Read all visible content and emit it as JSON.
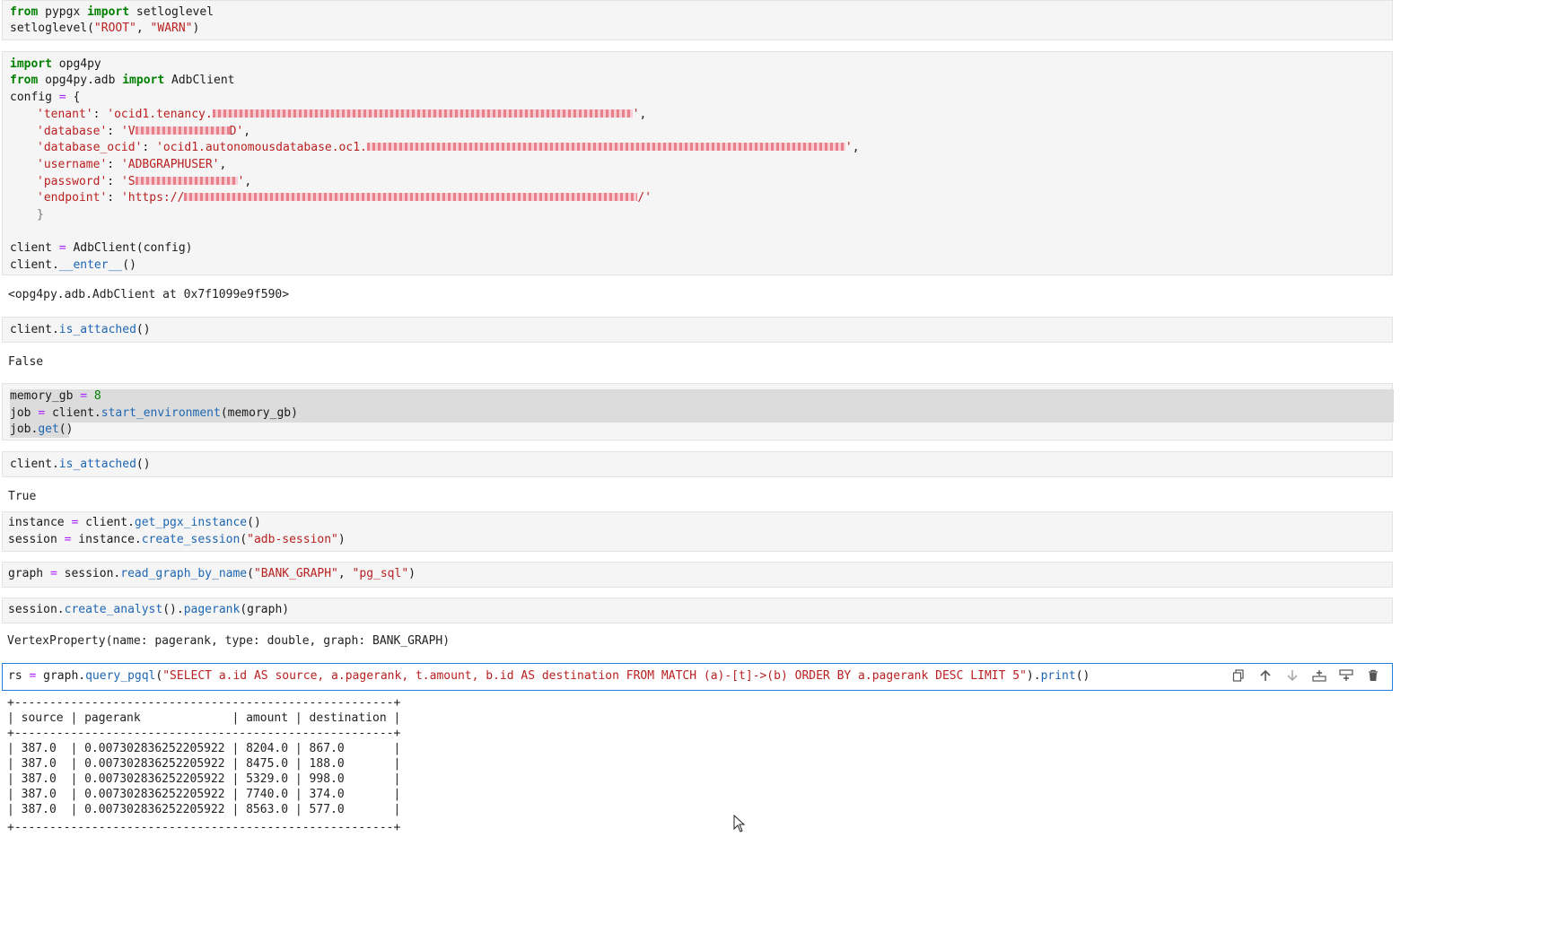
{
  "cells": {
    "c1": {
      "l1": {
        "kw1": "from",
        "mod": " pypgx ",
        "kw2": "import",
        "rest": " setloglevel"
      },
      "l2": {
        "fn": "setloglevel(",
        "s1": "\"ROOT\"",
        "sep": ", ",
        "s2": "\"WARN\"",
        "end": ")"
      }
    },
    "c2": {
      "l1": {
        "kw": "import",
        "rest": " opg4py"
      },
      "l2": {
        "kw1": "from",
        "mod": " opg4py.adb ",
        "kw2": "import",
        "rest": " AdbClient"
      },
      "l3": {
        "name": "config ",
        "op": "=",
        "rest": " {"
      },
      "tenant": {
        "key": "'tenant'",
        "sep": ": ",
        "val_start": "'ocid1.tenancy.",
        "val_end": "'",
        "tail": ","
      },
      "database": {
        "key": "'database'",
        "sep": ": ",
        "val_start": "'V",
        "val_end": "D'",
        "tail": ","
      },
      "database_ocid": {
        "key": "'database_ocid'",
        "sep": ": ",
        "val_start": "'ocid1.autonomousdatabase.oc1.",
        "val_end": "'",
        "tail": ","
      },
      "username": {
        "key": "'username'",
        "sep": ": ",
        "val": "'ADBGRAPHUSER'",
        "tail": ","
      },
      "password": {
        "key": "'password'",
        "sep": ": ",
        "val_start": "'S",
        "val_end": "'",
        "tail": ","
      },
      "endpoint": {
        "key": "'endpoint'",
        "sep": ": ",
        "val_start": "'https://",
        "val_end": "/'"
      },
      "close_brace": "}",
      "l10": {
        "name": "client ",
        "op": "=",
        "rest": " AdbClient(config)"
      },
      "l11": {
        "obj": "client.",
        "fn": "__enter__",
        "rest": "()"
      }
    },
    "o2": "<opg4py.adb.AdbClient at 0x7f1099e9f590>",
    "c3": {
      "obj": "client.",
      "fn": "is_attached",
      "rest": "()"
    },
    "o3": "False",
    "c4": {
      "l1": {
        "name": "memory_gb ",
        "op": "=",
        "num": " 8"
      },
      "l2": {
        "name": "job ",
        "op": "=",
        "obj": " client.",
        "fn": "start_environment",
        "rest": "(memory_gb)"
      },
      "l3": {
        "obj": "job.",
        "fn": "get",
        "rest": "()"
      }
    },
    "c5": {
      "obj": "client.",
      "fn": "is_attached",
      "rest": "()"
    },
    "o5": "True",
    "c6": {
      "l1": {
        "name": "instance ",
        "op": "=",
        "obj": " client.",
        "fn": "get_pgx_instance",
        "rest": "()"
      },
      "l2": {
        "name": "session ",
        "op": "=",
        "obj": " instance.",
        "fn": "create_session",
        "p": "(",
        "s": "\"adb-session\"",
        "e": ")"
      }
    },
    "c7": {
      "name": "graph ",
      "op": "=",
      "obj": " session.",
      "fn": "read_graph_by_name",
      "p": "(",
      "s1": "\"BANK_GRAPH\"",
      "sep": ", ",
      "s2": "\"pg_sql\"",
      "e": ")"
    },
    "c8": {
      "obj": "session.",
      "fn1": "create_analyst",
      "mid": "().",
      "fn2": "pagerank",
      "rest": "(graph)"
    },
    "o8": "VertexProperty(name: pagerank, type: double, graph: BANK_GRAPH)",
    "c9": {
      "name": "rs ",
      "op": "=",
      "obj": " graph.",
      "fn": "query_pgql",
      "p": "(",
      "s": "\"SELECT a.id AS source, a.pagerank, t.amount, b.id AS destination FROM MATCH (a)-[t]->(b) ORDER BY a.pagerank DESC LIMIT 5\"",
      "mid": ").",
      "fn2": "print",
      "e": "()"
    }
  },
  "toolbar": {
    "copy_icon": "copy-icon",
    "up_icon": "move-up-icon",
    "down_icon": "move-down-icon",
    "insert_above_icon": "insert-above-icon",
    "insert_below_icon": "insert-below-icon",
    "delete_icon": "delete-icon"
  },
  "result_table": {
    "border": "+------------------------------------------------------+",
    "header": "| source | pagerank             | amount | destination |",
    "rows": [
      "| 387.0  | 0.007302836252205922 | 8204.0 | 867.0       |",
      "| 387.0  | 0.007302836252205922 | 8475.0 | 188.0       |",
      "| 387.0  | 0.007302836252205922 | 5329.0 | 998.0       |",
      "| 387.0  | 0.007302836252205922 | 7740.0 | 374.0       |",
      "| 387.0  | 0.007302836252205922 | 8563.0 | 577.0       |"
    ]
  },
  "colors": {
    "keyword": "#008000",
    "string": "#ba2121",
    "function": "#1e66b3",
    "operator": "#aa22ff",
    "active_border": "#2a7bde"
  }
}
